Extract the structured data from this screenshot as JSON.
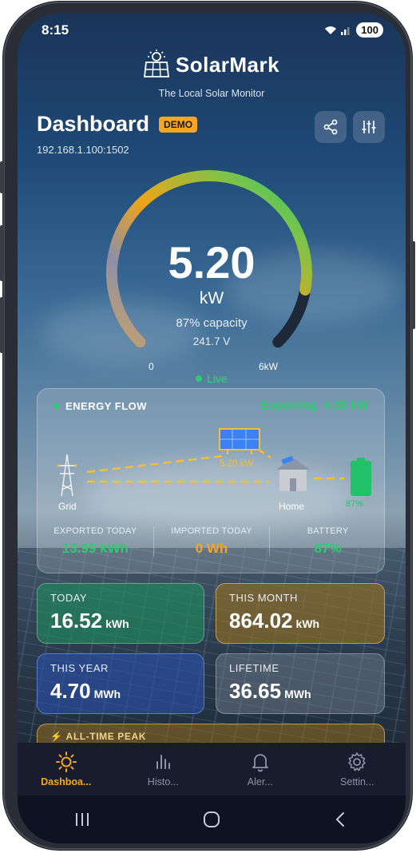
{
  "status": {
    "time": "8:15",
    "battery": "100"
  },
  "brand": {
    "name": "SolarMark",
    "tagline": "The Local Solar Monitor"
  },
  "header": {
    "title": "Dashboard",
    "badge": "DEMO",
    "ip": "192.168.1.100:1502"
  },
  "gauge": {
    "value": "5.20",
    "unit": "kW",
    "capacity": "87% capacity",
    "voltage": "241.7 V",
    "min_label": "0",
    "max_label": "6kW",
    "status": "Live",
    "fraction": 0.87
  },
  "flow": {
    "title": "ENERGY FLOW",
    "exporting_label": "Exporting",
    "exporting_value": "4.38 kW",
    "solar_value": "5.20 kW",
    "grid_label": "Grid",
    "home_label": "Home",
    "battery_label": "87%",
    "stats": [
      {
        "label": "EXPORTED TODAY",
        "value": "13.99 kWh",
        "color": "#2ecc71"
      },
      {
        "label": "IMPORTED TODAY",
        "value": "0 Wh",
        "color": "#f5a623"
      },
      {
        "label": "BATTERY",
        "value": "87%",
        "color": "#2ecc71"
      }
    ]
  },
  "tiles": {
    "today": {
      "label": "TODAY",
      "value": "16.52",
      "unit": "kWh"
    },
    "month": {
      "label": "THIS MONTH",
      "value": "864.02",
      "unit": "kWh"
    },
    "year": {
      "label": "THIS YEAR",
      "value": "4.70",
      "unit": "MWh"
    },
    "lifetime": {
      "label": "LIFETIME",
      "value": "36.65",
      "unit": "MWh"
    }
  },
  "peak": {
    "label": "ALL-TIME PEAK"
  },
  "nav": [
    {
      "label": "Dashboa...",
      "icon": "sun-icon",
      "active": true
    },
    {
      "label": "Histo...",
      "icon": "bar-chart-icon",
      "active": false
    },
    {
      "label": "Aler...",
      "icon": "bell-icon",
      "active": false
    },
    {
      "label": "Settin...",
      "icon": "gear-icon",
      "active": false
    }
  ],
  "colors": {
    "accent": "#f5a623",
    "positive": "#2ecc71"
  }
}
